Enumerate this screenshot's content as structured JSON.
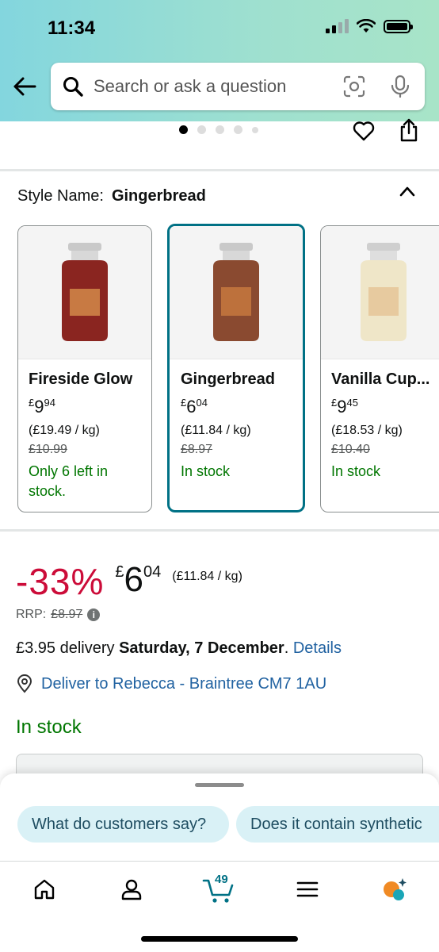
{
  "status_bar": {
    "time": "11:34"
  },
  "search": {
    "placeholder": "Search or ask a question"
  },
  "carousel": {
    "dot_count": 5,
    "active_index": 0
  },
  "style": {
    "label": "Style Name:",
    "value": "Gingerbread"
  },
  "variants": [
    {
      "name": "Fireside Glow",
      "currency": "£",
      "whole": "9",
      "fraction": "94",
      "unit_price": "(£19.49 / kg)",
      "was": "£10.99",
      "stock": "Only 6 left in stock.",
      "selected": false,
      "jar_color": "#8a2520"
    },
    {
      "name": "Gingerbread",
      "currency": "£",
      "whole": "6",
      "fraction": "04",
      "unit_price": "(£11.84 / kg)",
      "was": "£8.97",
      "stock": "In stock",
      "selected": true,
      "jar_color": "#8a4a30"
    },
    {
      "name": "Vanilla Cup...",
      "currency": "£",
      "whole": "9",
      "fraction": "45",
      "unit_price": "(£18.53 / kg)",
      "was": "£10.40",
      "stock": "In stock",
      "selected": false,
      "jar_color": "#efe6c8"
    }
  ],
  "price": {
    "discount": "-33%",
    "currency": "£",
    "whole": "6",
    "fraction": "04",
    "unit_price": "(£11.84 / kg)",
    "rrp_label": "RRP:",
    "rrp_value": "£8.97",
    "info_glyph": "i"
  },
  "delivery": {
    "cost_text": "£3.95 delivery ",
    "date_text": "Saturday, 7 December",
    "period": ". ",
    "details_link": "Details"
  },
  "deliver_to": "Deliver to Rebecca - Braintree CM7 1AU",
  "availability": "In stock",
  "suggestions": [
    "What do customers say?",
    "Does it contain synthetic"
  ],
  "bottom_nav": {
    "cart_count": "49"
  },
  "colors": {
    "accent": "#007185",
    "discount": "#cc0c39",
    "in_stock": "#007600",
    "link": "#2162a1"
  }
}
